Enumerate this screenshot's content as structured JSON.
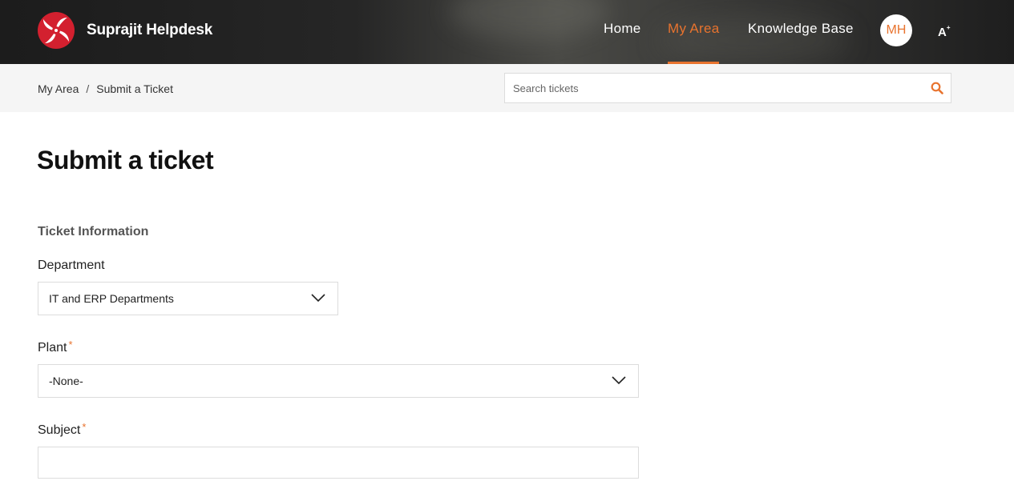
{
  "header": {
    "brand_name": "Suprajit Helpdesk",
    "nav": [
      {
        "label": "Home",
        "active": false
      },
      {
        "label": "My Area",
        "active": true
      },
      {
        "label": "Knowledge Base",
        "active": false
      }
    ],
    "avatar_initials": "MH",
    "font_toggle": "A"
  },
  "breadcrumb": {
    "items": [
      "My Area",
      "Submit a Ticket"
    ],
    "separator": "/"
  },
  "search": {
    "placeholder": "Search tickets",
    "icon": "search-icon"
  },
  "page": {
    "title": "Submit a ticket",
    "section_title": "Ticket Information"
  },
  "form": {
    "department": {
      "label": "Department",
      "value": "IT and ERP Departments"
    },
    "plant": {
      "label": "Plant",
      "required_mark": "*",
      "value": "-None-"
    },
    "subject": {
      "label": "Subject",
      "required_mark": "*",
      "value": ""
    }
  },
  "colors": {
    "accent": "#e8732e",
    "header_bg": "#222222",
    "subbar_bg": "#f5f5f5"
  }
}
